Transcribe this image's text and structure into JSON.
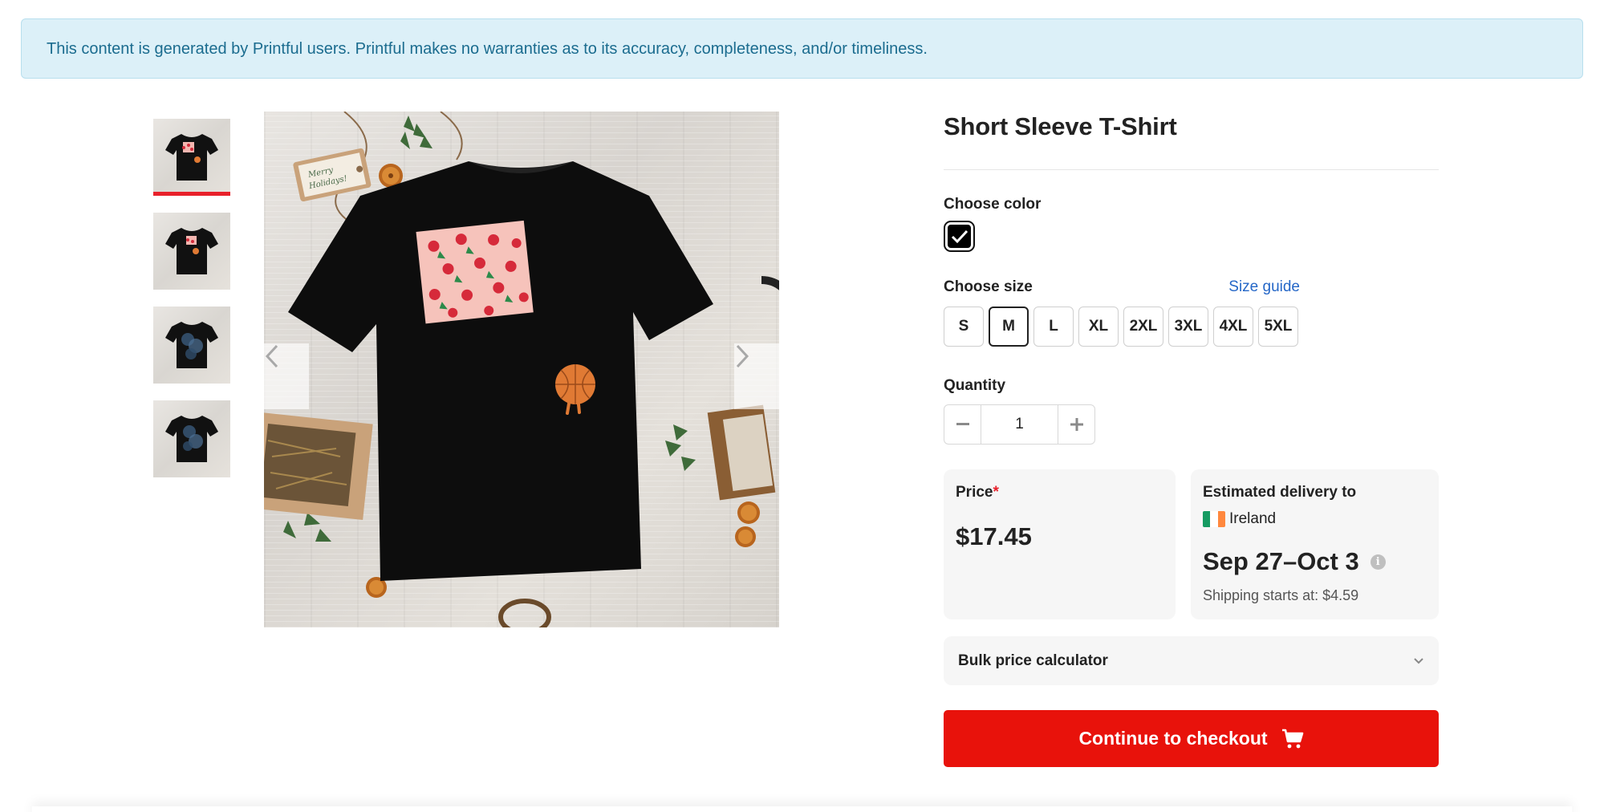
{
  "notice": {
    "text": "This content is generated by Printful users. Printful makes no warranties as to its accuracy, completeness, and/or timeliness."
  },
  "gallery": {
    "thumbnails": [
      {
        "icon": "tshirt-flowers-basketball-thumbnail",
        "active": true
      },
      {
        "icon": "tshirt-flowers-basketball-thumbnail",
        "active": false
      },
      {
        "icon": "tshirt-blue-print-thumbnail",
        "active": false
      },
      {
        "icon": "tshirt-blue-print-thumbnail",
        "active": false
      }
    ],
    "tag_text": "Merry Holidays!",
    "prev_icon": "chevron-left-icon",
    "next_icon": "chevron-right-icon"
  },
  "product": {
    "title": "Short Sleeve T-Shirt",
    "color_label": "Choose color",
    "selected_color": "#000000",
    "size_label": "Choose size",
    "size_guide": "Size guide",
    "sizes": [
      "S",
      "M",
      "L",
      "XL",
      "2XL",
      "3XL",
      "4XL",
      "5XL"
    ],
    "selected_size": "M",
    "quantity_label": "Quantity",
    "quantity": "1"
  },
  "price": {
    "label": "Price",
    "required_mark": "*",
    "value": "$17.45"
  },
  "delivery": {
    "label": "Estimated delivery to",
    "country": "Ireland",
    "flag_colors": [
      "#169b62",
      "#ffffff",
      "#ff883e"
    ],
    "dates": "Sep 27–Oct 3",
    "shipping": "Shipping starts at: $4.59"
  },
  "bulk": {
    "label": "Bulk price calculator"
  },
  "checkout": {
    "label": "Continue to checkout",
    "color": "#e8120b"
  }
}
